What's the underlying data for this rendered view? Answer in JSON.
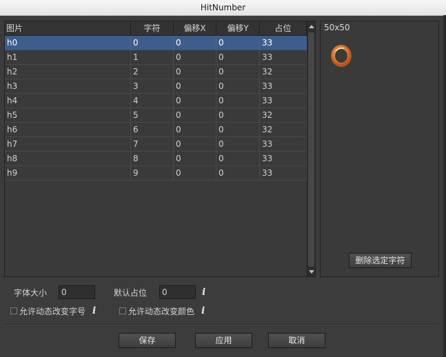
{
  "window": {
    "title": "HitNumber"
  },
  "table": {
    "columns": [
      "图片",
      "字符",
      "偏移X",
      "偏移Y",
      "占位"
    ],
    "selected_index": 0,
    "rows": [
      [
        "h0",
        "0",
        "0",
        "0",
        "33"
      ],
      [
        "h1",
        "1",
        "0",
        "0",
        "33"
      ],
      [
        "h2",
        "2",
        "0",
        "0",
        "32"
      ],
      [
        "h3",
        "3",
        "0",
        "0",
        "33"
      ],
      [
        "h4",
        "4",
        "0",
        "0",
        "33"
      ],
      [
        "h5",
        "5",
        "0",
        "0",
        "32"
      ],
      [
        "h6",
        "6",
        "0",
        "0",
        "32"
      ],
      [
        "h7",
        "7",
        "0",
        "0",
        "33"
      ],
      [
        "h8",
        "8",
        "0",
        "0",
        "33"
      ],
      [
        "h9",
        "9",
        "0",
        "0",
        "33"
      ]
    ]
  },
  "preview": {
    "size_label": "50x50",
    "image_icon": "digit-zero-ring-icon",
    "delete_button": "删除选定字符"
  },
  "settings": {
    "font_size_label": "字体大小",
    "font_size_value": "0",
    "default_space_label": "默认占位",
    "default_space_value": "0",
    "dynamic_font_size_label": "允许动态改变字号",
    "dynamic_font_size_checked": false,
    "dynamic_color_label": "允许动态改变颜色",
    "dynamic_color_checked": false,
    "info_glyph": "i"
  },
  "footer": {
    "save": "保存",
    "apply": "应用",
    "cancel": "取消"
  },
  "colors": {
    "background": "#3c3c3c",
    "selection": "#3d5d8d",
    "titlebar": "#ececec"
  }
}
